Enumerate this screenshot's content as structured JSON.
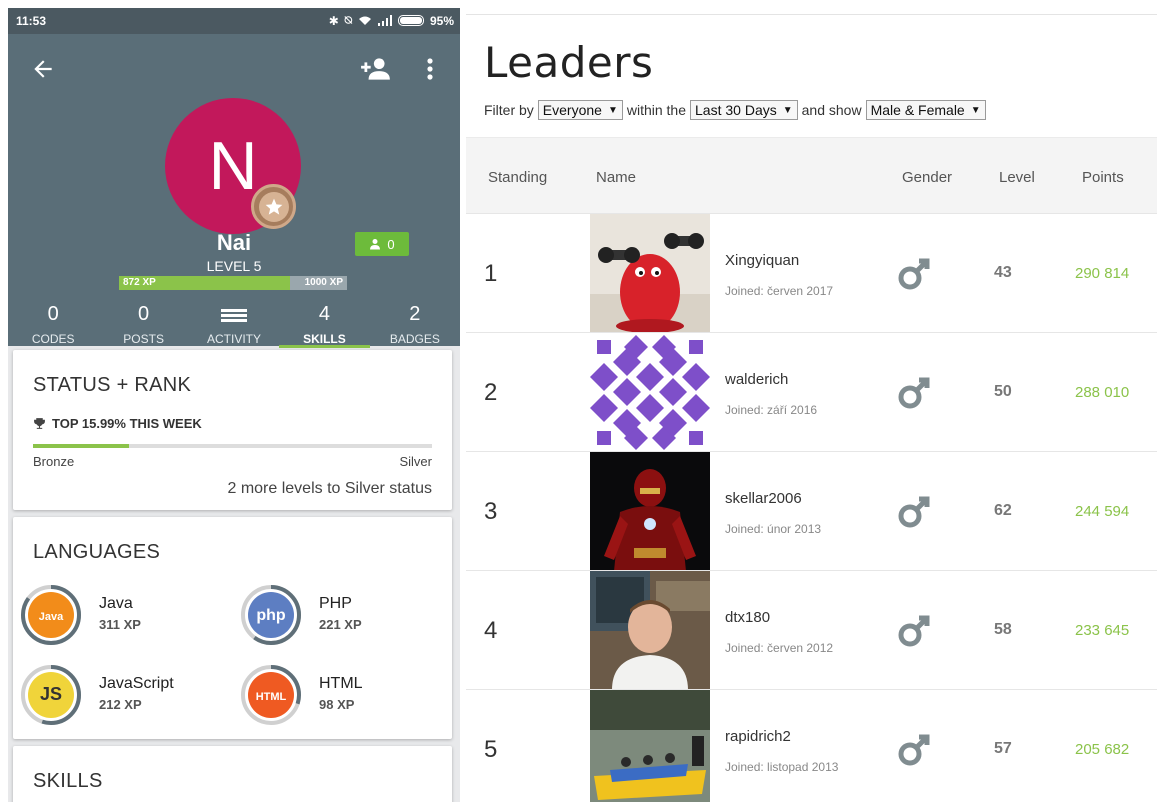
{
  "statusbar": {
    "time": "11:53",
    "battery": "95%"
  },
  "profile": {
    "avatar_letter": "N",
    "username": "Nai",
    "followers_count": "0",
    "level": "LEVEL 5",
    "xp_current": "872 XP",
    "xp_next": "1000 XP",
    "xp_progress": 0.75,
    "accent_color": "#c2185b",
    "header_color": "#5a6e78",
    "tabs": [
      {
        "count": "0",
        "label": "CODES"
      },
      {
        "count": "0",
        "label": "POSTS"
      },
      {
        "count": "",
        "label": "ACTIVITY"
      },
      {
        "count": "4",
        "label": "SKILLS"
      },
      {
        "count": "2",
        "label": "BADGES"
      }
    ],
    "active_tab": "SKILLS"
  },
  "status_card": {
    "title": "STATUS + RANK",
    "top_week": "TOP 15.99% THIS WEEK",
    "rank_from": "Bronze",
    "rank_to": "Silver",
    "rank_progress": 0.24,
    "note": "2 more levels to Silver status"
  },
  "languages_card": {
    "title": "LANGUAGES",
    "items": [
      {
        "name": "Java",
        "xp": "311 XP",
        "badge": "Java",
        "color": "#f28c1a",
        "progress": 0.85
      },
      {
        "name": "PHP",
        "xp": "221 XP",
        "badge": "php",
        "color": "#5d7ec2",
        "progress": 0.6
      },
      {
        "name": "JavaScript",
        "xp": "212 XP",
        "badge": "JS",
        "color": "#f0d43a",
        "progress": 0.55
      },
      {
        "name": "HTML",
        "xp": "98 XP",
        "badge": "HTML",
        "color": "#ef5a22",
        "progress": 0.3
      }
    ]
  },
  "skills_card": {
    "title": "SKILLS"
  },
  "leaders": {
    "title": "Leaders",
    "filter": {
      "label_filter_by": "Filter by",
      "who": "Everyone",
      "label_within": "within the",
      "period": "Last 30 Days",
      "label_show": "and show",
      "gender": "Male & Female"
    },
    "columns": [
      "Standing",
      "Name",
      "Gender",
      "Level",
      "Points"
    ],
    "points_color": "#8bc34a",
    "rows": [
      {
        "standing": "1",
        "name": "Xingyiquan",
        "joined": "Joined: červen 2017",
        "level": "43",
        "points": "290 814"
      },
      {
        "standing": "2",
        "name": "walderich",
        "joined": "Joined: září 2016",
        "level": "50",
        "points": "288 010"
      },
      {
        "standing": "3",
        "name": "skellar2006",
        "joined": "Joined: únor 2013",
        "level": "62",
        "points": "244 594"
      },
      {
        "standing": "4",
        "name": "dtx180",
        "joined": "Joined: červen 2012",
        "level": "58",
        "points": "233 645"
      },
      {
        "standing": "5",
        "name": "rapidrich2",
        "joined": "Joined: listopad 2013",
        "level": "57",
        "points": "205 682"
      }
    ]
  }
}
